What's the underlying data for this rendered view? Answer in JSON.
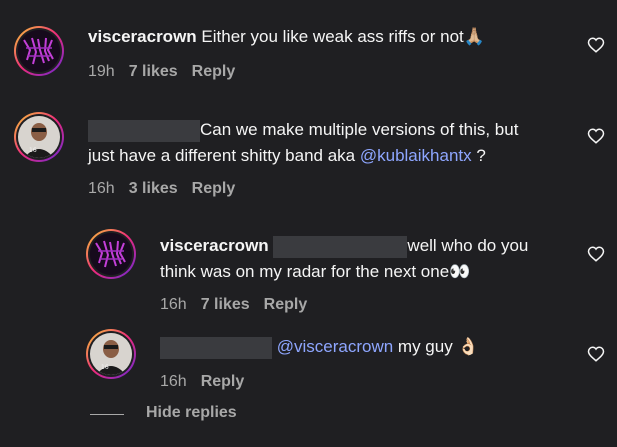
{
  "comments": [
    {
      "username": "visceracrown",
      "text": "Either you like weak ass riffs or not",
      "emoji": "🙏🏼",
      "time": "19h",
      "likes": "7 likes",
      "reply": "Reply"
    },
    {
      "text_line1": "Can we make multiple versions of this, but",
      "text_line2_prefix": "just have a different shitty band aka ",
      "mention": "@kublaikhantx",
      "text_line2_suffix": " ?",
      "time": "16h",
      "likes": "3 likes",
      "reply": "Reply"
    },
    {
      "username": "visceracrown",
      "text_line1": "well who do you",
      "text_line2": "think was on my radar for the next one",
      "emoji": "👀",
      "time": "16h",
      "likes": "7 likes",
      "reply": "Reply"
    },
    {
      "mention": "@visceracrown",
      "text": " my guy ",
      "emoji": "👌🏻",
      "time": "16h",
      "reply": "Reply"
    }
  ],
  "hide_replies": "Hide replies",
  "icons": {
    "like": "heart-outline-icon"
  }
}
